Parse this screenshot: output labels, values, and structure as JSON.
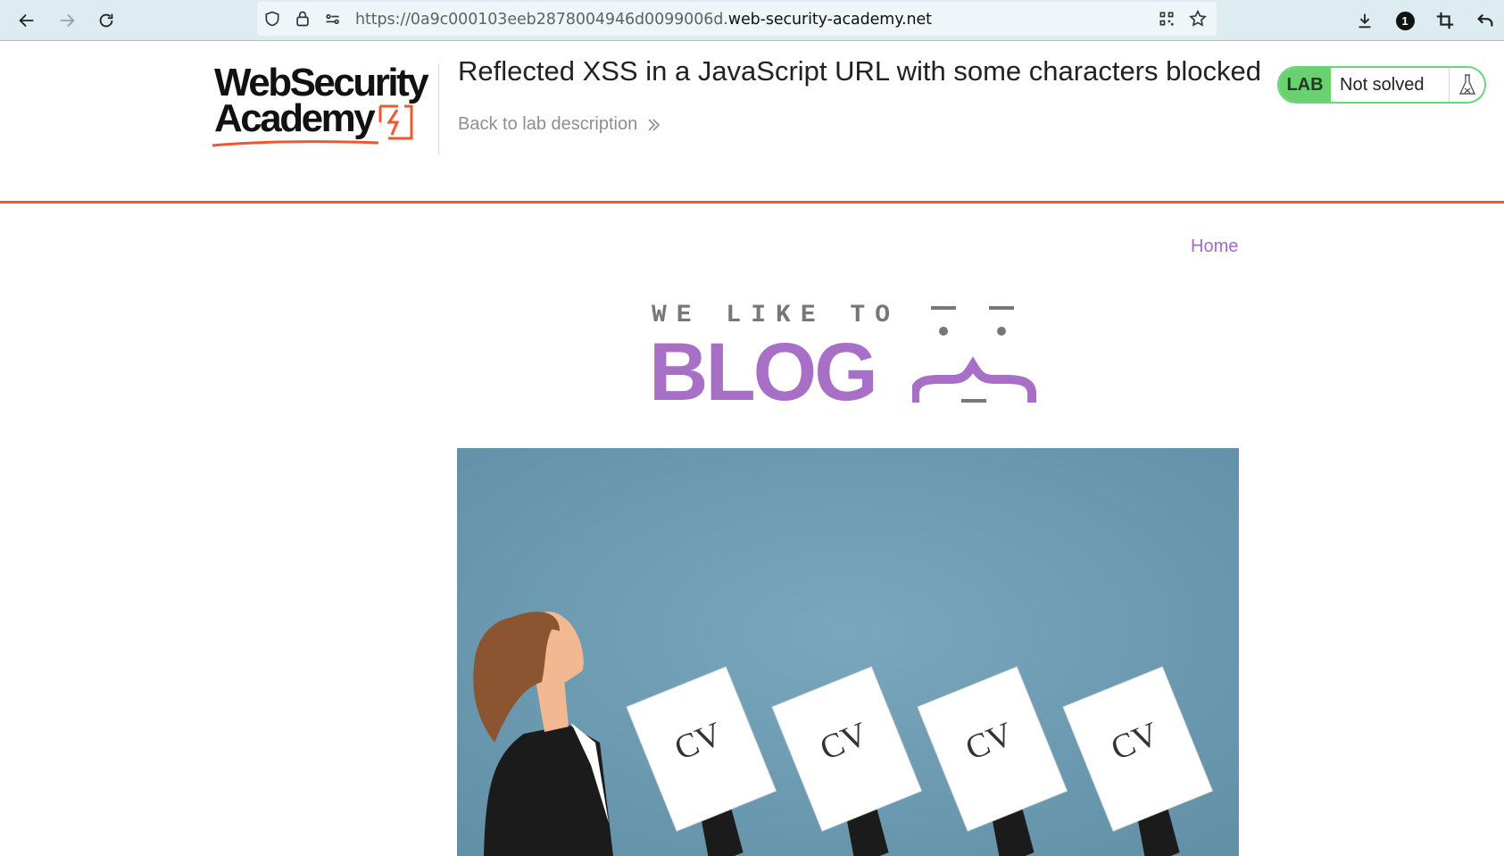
{
  "browser": {
    "url_prefix": "https://0a9c000103eeb2878004946d0099006d.",
    "url_host": "web-security-academy.net",
    "nav_icons": [
      "back-arrow-icon",
      "forward-arrow-icon",
      "reload-icon"
    ],
    "url_icons": [
      "shield-icon",
      "lock-icon",
      "permissions-icon"
    ],
    "right_icons": [
      "qr-code-icon",
      "bookmark-star-icon",
      "download-icon",
      "extension-badge-icon",
      "crop-icon",
      "undo-icon"
    ],
    "badge_count": "1"
  },
  "lab": {
    "logo_line1": "WebSecurity",
    "logo_line2": "Academy",
    "title": "Reflected XSS in a JavaScript URL with some characters blocked",
    "back_link": "Back to lab description",
    "status_tag": "LAB",
    "status_text": "Not solved",
    "accent_color": "#f0572e",
    "status_color": "#6ad170"
  },
  "blog": {
    "home_link": "Home",
    "banner_top": "WE LIKE TO",
    "banner_main": "BLOG",
    "banner_color": "#a86fc6",
    "image_cv_labels": [
      "CV",
      "CV",
      "CV",
      "CV"
    ]
  }
}
